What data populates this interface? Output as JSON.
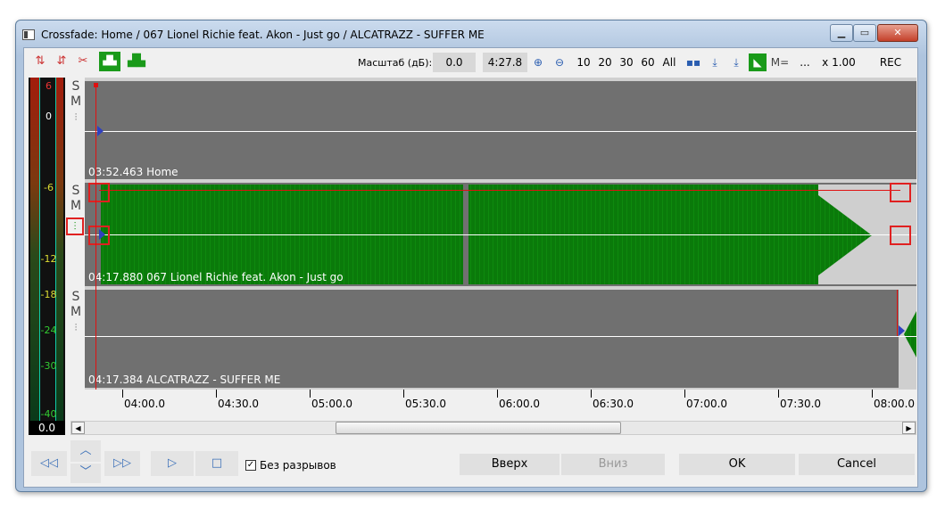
{
  "window": {
    "title": "Crossfade: Home / 067 Lionel Richie feat. Akon - Just go / ALCATRAZZ - SUFFER ME"
  },
  "toolbar": {
    "scale_label": "Масштаб (дБ):",
    "scale_value": "0.0",
    "position_value": "4:27.8",
    "zoom_options": [
      "10",
      "20",
      "30",
      "60",
      "All"
    ],
    "speed": "x 1.00",
    "more": "...",
    "rec": "REC",
    "m_label": "M="
  },
  "meter": {
    "ticks": [
      "6",
      "0",
      "-6",
      "-12",
      "-18",
      "-24",
      "-30",
      "-40"
    ],
    "value": "0.0"
  },
  "tracks": [
    {
      "s": "S",
      "m": "M",
      "label": "03:52.463 Home"
    },
    {
      "s": "S",
      "m": "M",
      "label": "04:17.880 067 Lionel Richie feat. Akon - Just go"
    },
    {
      "s": "S",
      "m": "M",
      "label": "04:17.384 ALCATRAZZ - SUFFER ME"
    }
  ],
  "ruler": {
    "labels": [
      "04:00.0",
      "04:30.0",
      "05:00.0",
      "05:30.0",
      "06:00.0",
      "06:30.0",
      "07:00.0",
      "07:30.0",
      "08:00.0"
    ]
  },
  "bottom": {
    "no_gaps_label": "Без разрывов",
    "no_gaps_checked": true,
    "up": "Вверх",
    "down": "Вниз",
    "ok": "OK",
    "cancel": "Cancel"
  },
  "colors": {
    "waveform": "#0a7a0a",
    "crossfade_line": "#e01010",
    "track_bg": "#707070"
  }
}
